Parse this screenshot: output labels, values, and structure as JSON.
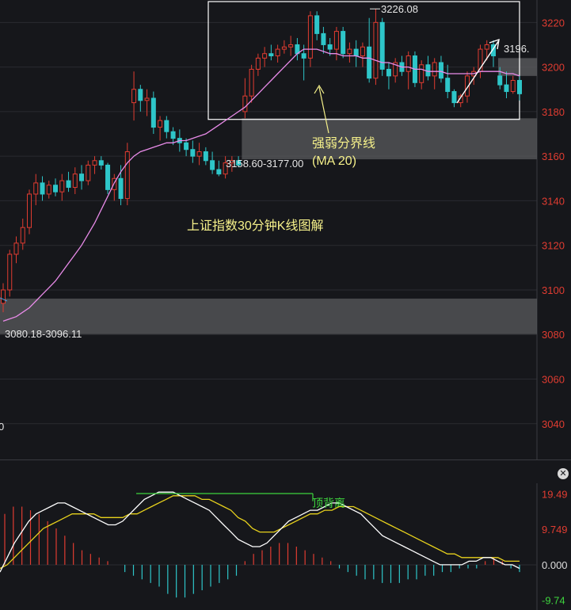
{
  "chart_data": [
    {
      "type": "candlestick",
      "title": "",
      "annotation_title": "上证指数30分钟K线图解",
      "y_ticks": [
        "3220",
        "3200",
        "3180",
        "3160",
        "3140",
        "3120",
        "3100",
        "3080",
        "3060",
        "3040"
      ],
      "y_tick_values": [
        3220,
        3200,
        3180,
        3160,
        3140,
        3120,
        3100,
        3080,
        3060,
        3040
      ],
      "ylim": [
        3025,
        3229
      ],
      "colors": {
        "up": "#e03c31",
        "down": "#2ec6c9",
        "ma20": "#e98be9",
        "grid": "#2a2b30",
        "axis_text": "#e03c31",
        "box": "#ffffff",
        "zone": "#5a5b5e",
        "annot": "#f5f08a"
      },
      "ma_label": "强弱分界线",
      "ma_sublabel": "(MA 20)",
      "high_label": "3226.08",
      "high_value": 3226.08,
      "right_label": "3196.",
      "zone_upper_label": "3158.60-3177.00",
      "zone_lower_label": "3080.18-3096.11",
      "zone_upper": [
        3158.6,
        3177.0
      ],
      "zone_lower": [
        3080.18,
        3096.11
      ],
      "left_cut_label": "0",
      "ohlc": [
        [
          3094,
          3103,
          3090,
          3100
        ],
        [
          3100,
          3118,
          3097,
          3116
        ],
        [
          3116,
          3124,
          3112,
          3121
        ],
        [
          3121,
          3132,
          3118,
          3128
        ],
        [
          3128,
          3145,
          3125,
          3143
        ],
        [
          3143,
          3152,
          3138,
          3148
        ],
        [
          3148,
          3151,
          3140,
          3143
        ],
        [
          3143,
          3149,
          3141,
          3147
        ],
        [
          3147,
          3150,
          3142,
          3144
        ],
        [
          3144,
          3152,
          3140,
          3149
        ],
        [
          3149,
          3153,
          3144,
          3146
        ],
        [
          3146,
          3155,
          3143,
          3152
        ],
        [
          3152,
          3156,
          3145,
          3149
        ],
        [
          3149,
          3158,
          3147,
          3156
        ],
        [
          3156,
          3160,
          3152,
          3158
        ],
        [
          3158,
          3160,
          3154,
          3156
        ],
        [
          3156,
          3157,
          3143,
          3145
        ],
        [
          3145,
          3152,
          3140,
          3150
        ],
        [
          3150,
          3156,
          3138,
          3141
        ],
        [
          3141,
          3166,
          3138,
          3162
        ],
        [
          3184,
          3198,
          3176,
          3190
        ],
        [
          3190,
          3192,
          3180,
          3185
        ],
        [
          3185,
          3190,
          3178,
          3186
        ],
        [
          3186,
          3189,
          3170,
          3173
        ],
        [
          3173,
          3178,
          3167,
          3176
        ],
        [
          3176,
          3178,
          3168,
          3171
        ],
        [
          3171,
          3173,
          3165,
          3168
        ],
        [
          3168,
          3172,
          3162,
          3166
        ],
        [
          3166,
          3168,
          3160,
          3163
        ],
        [
          3163,
          3167,
          3157,
          3160
        ],
        [
          3160,
          3166,
          3156,
          3162
        ],
        [
          3162,
          3164,
          3156,
          3158
        ],
        [
          3158,
          3162,
          3152,
          3154
        ],
        [
          3154,
          3158,
          3151,
          3152
        ],
        [
          3152,
          3160,
          3150,
          3157
        ],
        [
          3157,
          3160,
          3153,
          3158
        ],
        [
          3158,
          3160,
          3155,
          3156
        ],
        [
          3180,
          3195,
          3177,
          3187
        ],
        [
          3187,
          3201,
          3184,
          3199
        ],
        [
          3199,
          3206,
          3196,
          3204
        ],
        [
          3204,
          3209,
          3200,
          3206
        ],
        [
          3206,
          3210,
          3203,
          3205
        ],
        [
          3205,
          3210,
          3202,
          3208
        ],
        [
          3208,
          3212,
          3206,
          3209
        ],
        [
          3209,
          3214,
          3205,
          3210
        ],
        [
          3210,
          3213,
          3203,
          3206
        ],
        [
          3206,
          3210,
          3194,
          3204
        ],
        [
          3204,
          3225,
          3200,
          3223
        ],
        [
          3223,
          3225,
          3212,
          3215
        ],
        [
          3215,
          3218,
          3206,
          3210
        ],
        [
          3210,
          3213,
          3205,
          3208
        ],
        [
          3208,
          3218,
          3203,
          3216
        ],
        [
          3216,
          3218,
          3204,
          3206
        ],
        [
          3206,
          3211,
          3202,
          3208
        ],
        [
          3208,
          3212,
          3200,
          3205
        ],
        [
          3205,
          3211,
          3200,
          3209
        ],
        [
          3209,
          3222,
          3193,
          3195
        ],
        [
          3195,
          3226,
          3192,
          3220
        ],
        [
          3220,
          3222,
          3196,
          3199
        ],
        [
          3199,
          3202,
          3190,
          3196
        ],
        [
          3196,
          3204,
          3193,
          3202
        ],
        [
          3202,
          3205,
          3196,
          3198
        ],
        [
          3198,
          3207,
          3190,
          3205
        ],
        [
          3205,
          3207,
          3191,
          3193
        ],
        [
          3193,
          3203,
          3190,
          3201
        ],
        [
          3201,
          3205,
          3194,
          3196
        ],
        [
          3196,
          3204,
          3190,
          3202
        ],
        [
          3202,
          3205,
          3193,
          3195
        ],
        [
          3195,
          3201,
          3186,
          3189
        ],
        [
          3189,
          3190,
          3182,
          3184
        ],
        [
          3184,
          3188,
          3182,
          3187
        ],
        [
          3187,
          3198,
          3184,
          3196
        ],
        [
          3196,
          3200,
          3192,
          3198
        ],
        [
          3198,
          3210,
          3195,
          3208
        ],
        [
          3208,
          3212,
          3203,
          3210
        ],
        [
          3210,
          3212,
          3200,
          3205
        ],
        [
          3196,
          3200,
          3190,
          3192
        ],
        [
          3192,
          3198,
          3186,
          3189
        ],
        [
          3189,
          3196,
          3188,
          3194
        ],
        [
          3194,
          3196,
          3185,
          3188
        ]
      ],
      "ma20": [
        3086,
        3087,
        3088,
        3090,
        3092,
        3095,
        3098,
        3101,
        3104,
        3108,
        3112,
        3116,
        3120,
        3125,
        3130,
        3136,
        3142,
        3148,
        3153,
        3157,
        3160,
        3162,
        3163,
        3164,
        3165,
        3166,
        3166,
        3167,
        3167,
        3168,
        3169,
        3170,
        3172,
        3174,
        3176,
        3178,
        3180,
        3182,
        3185,
        3188,
        3191,
        3194,
        3197,
        3200,
        3203,
        3206,
        3208,
        3208,
        3208,
        3207,
        3206,
        3206,
        3205,
        3205,
        3205,
        3204,
        3204,
        3203,
        3202,
        3202,
        3201,
        3200,
        3200,
        3199,
        3199,
        3198,
        3198,
        3198,
        3197,
        3197,
        3197,
        3197,
        3197,
        3198,
        3198,
        3198,
        3198,
        3197,
        3197,
        3196
      ]
    },
    {
      "type": "macd",
      "y_ticks": [
        "19.49",
        "9.749",
        "0.000",
        "-9.74"
      ],
      "y_tick_values": [
        19.49,
        9.749,
        0.0,
        -9.74
      ],
      "ylim": [
        -12,
        22
      ],
      "divergence_label": "顶背离",
      "colors": {
        "dif": "#ffffff",
        "dea": "#e8d21c",
        "hist_pos": "#e03c31",
        "hist_neg": "#2ec6c9",
        "divergence": "#3ed43e",
        "axis_up": "#e03c31",
        "axis_zero": "#dddddd",
        "axis_down": "#3ed43e"
      },
      "dif": [
        -2,
        2,
        6,
        9,
        12,
        14,
        15,
        16,
        17,
        17,
        16,
        15,
        14,
        13,
        12,
        11,
        11,
        12,
        14,
        16,
        18,
        19,
        20,
        20,
        20,
        19,
        18,
        17,
        16,
        15,
        13,
        11,
        9,
        7,
        6,
        5,
        5,
        6,
        8,
        10,
        12,
        13,
        14,
        15,
        15,
        16,
        17,
        17,
        16,
        15,
        14,
        12,
        10,
        8,
        7,
        6,
        5,
        4,
        3,
        2,
        1,
        0,
        0,
        0,
        0,
        1,
        1,
        2,
        2,
        1,
        0,
        0,
        -1
      ],
      "dea": [
        -1,
        0,
        2,
        4,
        6,
        8,
        10,
        11,
        12,
        13,
        14,
        14,
        14,
        14,
        13,
        13,
        13,
        13,
        14,
        14,
        15,
        16,
        17,
        18,
        19,
        19,
        19,
        19,
        18,
        18,
        17,
        16,
        15,
        13,
        12,
        10,
        9,
        9,
        9,
        10,
        11,
        12,
        13,
        14,
        14,
        15,
        15,
        16,
        16,
        16,
        15,
        14,
        13,
        12,
        11,
        10,
        9,
        8,
        7,
        6,
        5,
        4,
        3,
        3,
        2,
        2,
        2,
        2,
        2,
        2,
        1,
        1,
        1
      ],
      "hist": [
        14,
        16,
        16,
        15,
        14,
        12,
        10,
        8,
        6,
        4,
        3,
        2,
        1,
        0,
        -2,
        -3,
        -4,
        -5,
        -6,
        -8,
        -9,
        -9,
        -8,
        -7,
        -6,
        -5,
        -4,
        -3,
        1,
        3,
        4,
        5,
        6,
        6,
        5,
        4,
        3,
        2,
        1,
        -1,
        -2,
        -3,
        -4,
        -4,
        -5,
        -5,
        -5,
        -4,
        -4,
        -3,
        -3,
        -2,
        -2,
        -1,
        -1,
        -1,
        1,
        2,
        1,
        -1,
        -2
      ]
    }
  ]
}
